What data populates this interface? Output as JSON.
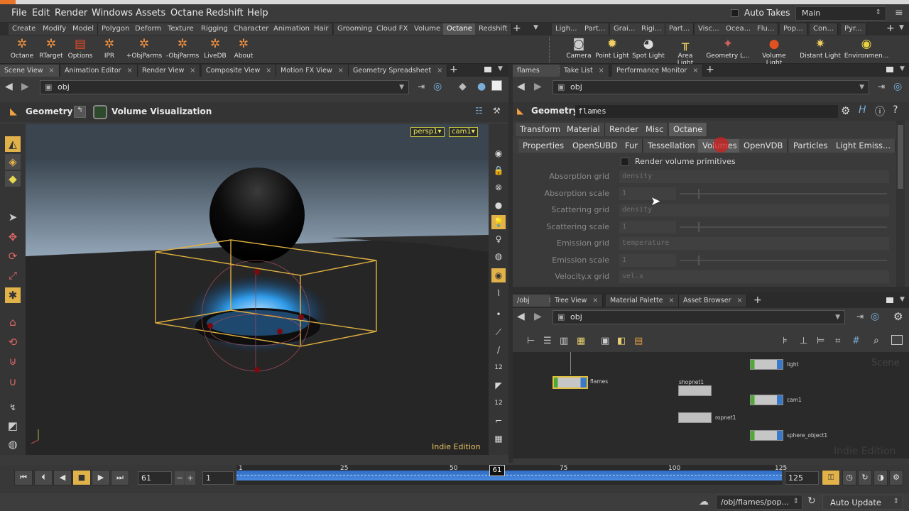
{
  "menubar": {
    "items": [
      "File",
      "Edit",
      "Render",
      "Windows",
      "Assets",
      "Octane",
      "Redshift",
      "Help"
    ],
    "auto_takes": "Auto Takes",
    "take": "Main"
  },
  "shelf_tabs": [
    "Create",
    "Modify",
    "Model",
    "Polygon",
    "Deform",
    "Texture",
    "Rigging",
    "Character",
    "Animation",
    "Hair",
    "Grooming",
    "Cloud FX",
    "Volume",
    "Octane",
    "Redshift"
  ],
  "shelf_tabs_right": [
    "Ligh...",
    "Part...",
    "Grai...",
    "Rigi...",
    "Part...",
    "Visc...",
    "Ocea...",
    "Flu...",
    "Pop...",
    "Con...",
    "Pyr..."
  ],
  "shelf_tools": [
    "Octane",
    "RTarget",
    "Options",
    "IPR",
    "+ObjParms",
    "-ObjParms",
    "LiveDB",
    "About"
  ],
  "shelf_tools_right": [
    "Camera",
    "Point Light",
    "Spot Light",
    "Area Light",
    "Geometry L...",
    "Volume Light",
    "Distant Light",
    "Environmen..."
  ],
  "left_pane": {
    "tabs": [
      "Scene View",
      "Animation Editor",
      "Render View",
      "Composite View",
      "Motion FX View",
      "Geometry Spreadsheet"
    ],
    "path": "obj",
    "context_label": "Geometry",
    "context_node": "Volume Visualization",
    "camera_menu": "persp1▾",
    "cam_menu": "cam1▾",
    "watermark": "Indie Edition"
  },
  "param_pane": {
    "tabs": [
      "flames",
      "Take List",
      "Performance Monitor"
    ],
    "path": "obj",
    "node_type": "Geometry",
    "node_name": "flames",
    "top_tabs": [
      "Transform",
      "Material",
      "Render",
      "Misc",
      "Octane"
    ],
    "sub_tabs": [
      "Properties",
      "OpenSUBD",
      "Fur",
      "Tessellation",
      "Volumes",
      "OpenVDB",
      "Particles",
      "Light Emiss..."
    ],
    "active_sub_tab": "Volumes",
    "render_volume_label": "Render volume primitives",
    "params": [
      {
        "label": "Absorption grid",
        "value": "density",
        "kind": "text"
      },
      {
        "label": "Absorption scale",
        "value": "1",
        "kind": "slider"
      },
      {
        "label": "Scattering grid",
        "value": "density",
        "kind": "text"
      },
      {
        "label": "Scattering scale",
        "value": "1",
        "kind": "slider"
      },
      {
        "label": "Emission grid",
        "value": "temperature",
        "kind": "text"
      },
      {
        "label": "Emission scale",
        "value": "1",
        "kind": "slider"
      },
      {
        "label": "Velocity.x grid",
        "value": "vel.x",
        "kind": "text"
      }
    ]
  },
  "net_pane": {
    "tabs": [
      "/obj",
      "Tree View",
      "Material Palette",
      "Asset Browser"
    ],
    "path": "obj",
    "scene_watermark": "Scene",
    "indie_watermark": "Indie Edition",
    "nodes": [
      "flames",
      "shopnet1",
      "ropnet1",
      "light",
      "cam1",
      "sphere_object1"
    ]
  },
  "timeline": {
    "current_frame": "61",
    "start_frame": "1",
    "end_frame": "125",
    "ruler_start": "1",
    "ruler_ticks": [
      "25",
      "50",
      "75",
      "100"
    ],
    "ruler_current": "61",
    "ruler_end": "125"
  },
  "status": {
    "path": "/obj/flames/pop...",
    "update_mode": "Auto Update"
  }
}
